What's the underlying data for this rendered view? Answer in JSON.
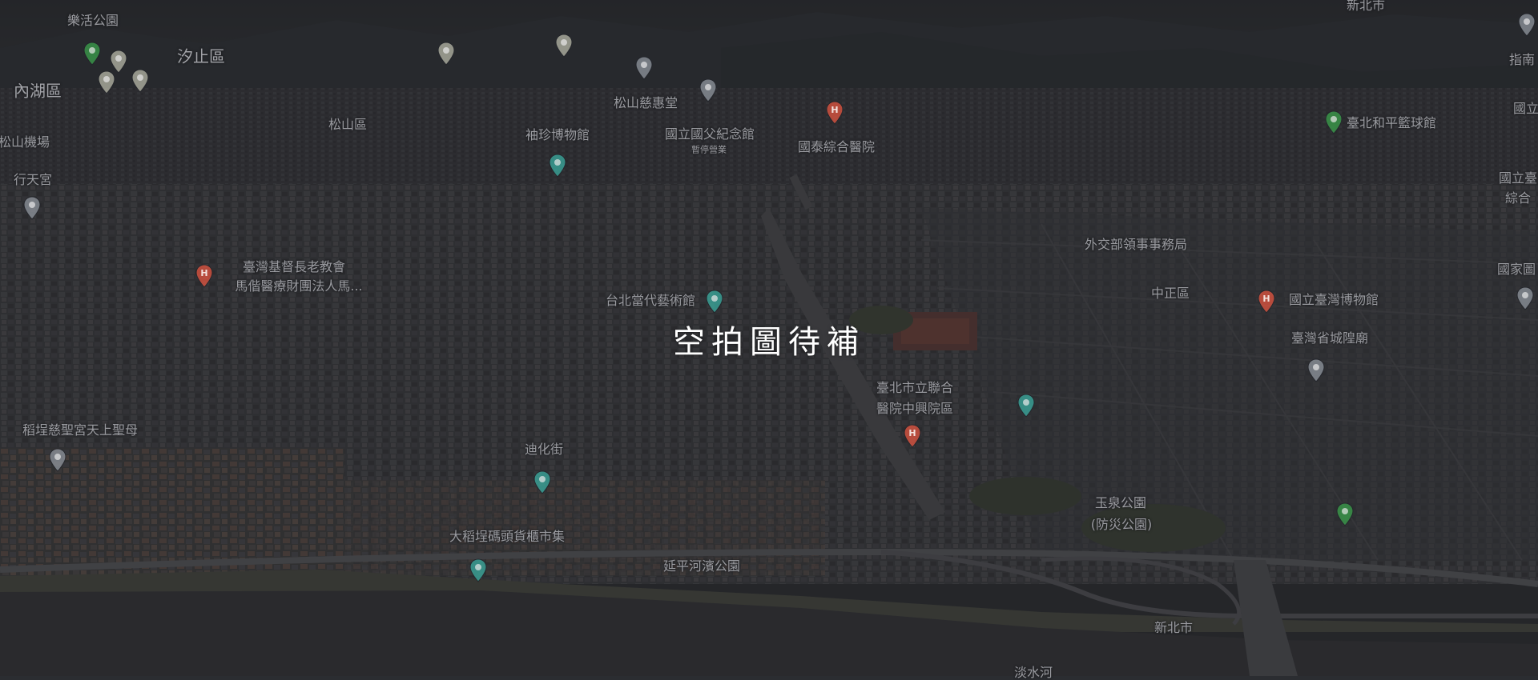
{
  "overlay": {
    "title": "空拍圖待補"
  },
  "labels": [
    {
      "id": "l0",
      "text": "樂活公園"
    },
    {
      "id": "l1",
      "text": "汐止區"
    },
    {
      "id": "l2",
      "text": "內湖區"
    },
    {
      "id": "l3",
      "text": "松山區"
    },
    {
      "id": "l4",
      "text": "松山機場"
    },
    {
      "id": "l5",
      "text": "行天宮"
    },
    {
      "id": "l6",
      "text": "袖珍博物館"
    },
    {
      "id": "l7",
      "text": "松山慈惠堂"
    },
    {
      "id": "l8",
      "text": "國立國父紀念館"
    },
    {
      "id": "l9",
      "text": "暫停營業"
    },
    {
      "id": "l10",
      "text": "國泰綜合醫院"
    },
    {
      "id": "l11",
      "text": "新北市"
    },
    {
      "id": "l12",
      "text": "指南"
    },
    {
      "id": "l13",
      "text": "國立"
    },
    {
      "id": "l14",
      "text": "臺北和平籃球館"
    },
    {
      "id": "l15",
      "text": "國立臺"
    },
    {
      "id": "l16",
      "text": "綜合"
    },
    {
      "id": "l17",
      "text": "外交部領事事務局"
    },
    {
      "id": "l18",
      "text": "國家圖"
    },
    {
      "id": "l19",
      "text": "中正區"
    },
    {
      "id": "l20",
      "text": "國立臺灣博物館"
    },
    {
      "id": "l21",
      "text": "臺灣省城隍廟"
    },
    {
      "id": "l22",
      "text": "臺灣基督長老教會"
    },
    {
      "id": "l23",
      "text": "馬偕醫療財團法人馬..."
    },
    {
      "id": "l24",
      "text": "台北當代藝術館"
    },
    {
      "id": "l25",
      "text": "臺北市立聯合"
    },
    {
      "id": "l26",
      "text": "醫院中興院區"
    },
    {
      "id": "l27",
      "text": "稻埕慈聖宮天上聖母"
    },
    {
      "id": "l28",
      "text": "迪化街"
    },
    {
      "id": "l29",
      "text": "玉泉公園"
    },
    {
      "id": "l30",
      "text": "(防災公園)"
    },
    {
      "id": "l31",
      "text": "大稻埕碼頭貨櫃市集"
    },
    {
      "id": "l32",
      "text": "延平河濱公園"
    },
    {
      "id": "l33",
      "text": "新北市"
    },
    {
      "id": "l34",
      "text": "淡水河"
    }
  ],
  "pins": [
    {
      "id": "p0",
      "kind": "park",
      "color": "#3a9a4a"
    },
    {
      "id": "p1",
      "kind": "flower",
      "color": "#b8b8a8"
    },
    {
      "id": "p2",
      "kind": "flower",
      "color": "#b8b8a8"
    },
    {
      "id": "p3",
      "kind": "flower",
      "color": "#b8b8a8"
    },
    {
      "id": "p4",
      "kind": "flower",
      "color": "#b8b8a8"
    },
    {
      "id": "p5",
      "kind": "flower",
      "color": "#b8b8a8"
    },
    {
      "id": "p6",
      "kind": "place",
      "color": "#8a9098"
    },
    {
      "id": "p7",
      "kind": "place",
      "color": "#8a9098"
    },
    {
      "id": "p8",
      "kind": "hospital",
      "color": "#d9533f"
    },
    {
      "id": "p9",
      "kind": "park",
      "color": "#3a9a4a"
    },
    {
      "id": "p10",
      "kind": "museum",
      "color": "#3aa59a"
    },
    {
      "id": "p11",
      "kind": "place",
      "color": "#8a9098"
    },
    {
      "id": "p12",
      "kind": "hospital",
      "color": "#d9533f"
    },
    {
      "id": "p13",
      "kind": "museum",
      "color": "#3aa59a"
    },
    {
      "id": "p14",
      "kind": "hospital",
      "color": "#d9533f"
    },
    {
      "id": "p15",
      "kind": "place",
      "color": "#8a9098"
    },
    {
      "id": "p16",
      "kind": "hospital",
      "color": "#d9533f"
    },
    {
      "id": "p17",
      "kind": "museum",
      "color": "#3aa59a"
    },
    {
      "id": "p18",
      "kind": "place",
      "color": "#8a9098"
    },
    {
      "id": "p19",
      "kind": "shopping",
      "color": "#3aa59a"
    },
    {
      "id": "p20",
      "kind": "shopping",
      "color": "#3aa59a"
    },
    {
      "id": "p21",
      "kind": "park",
      "color": "#3a9a4a"
    },
    {
      "id": "p22",
      "kind": "place",
      "color": "#8a9098"
    },
    {
      "id": "p23",
      "kind": "place",
      "color": "#8a9098"
    }
  ]
}
